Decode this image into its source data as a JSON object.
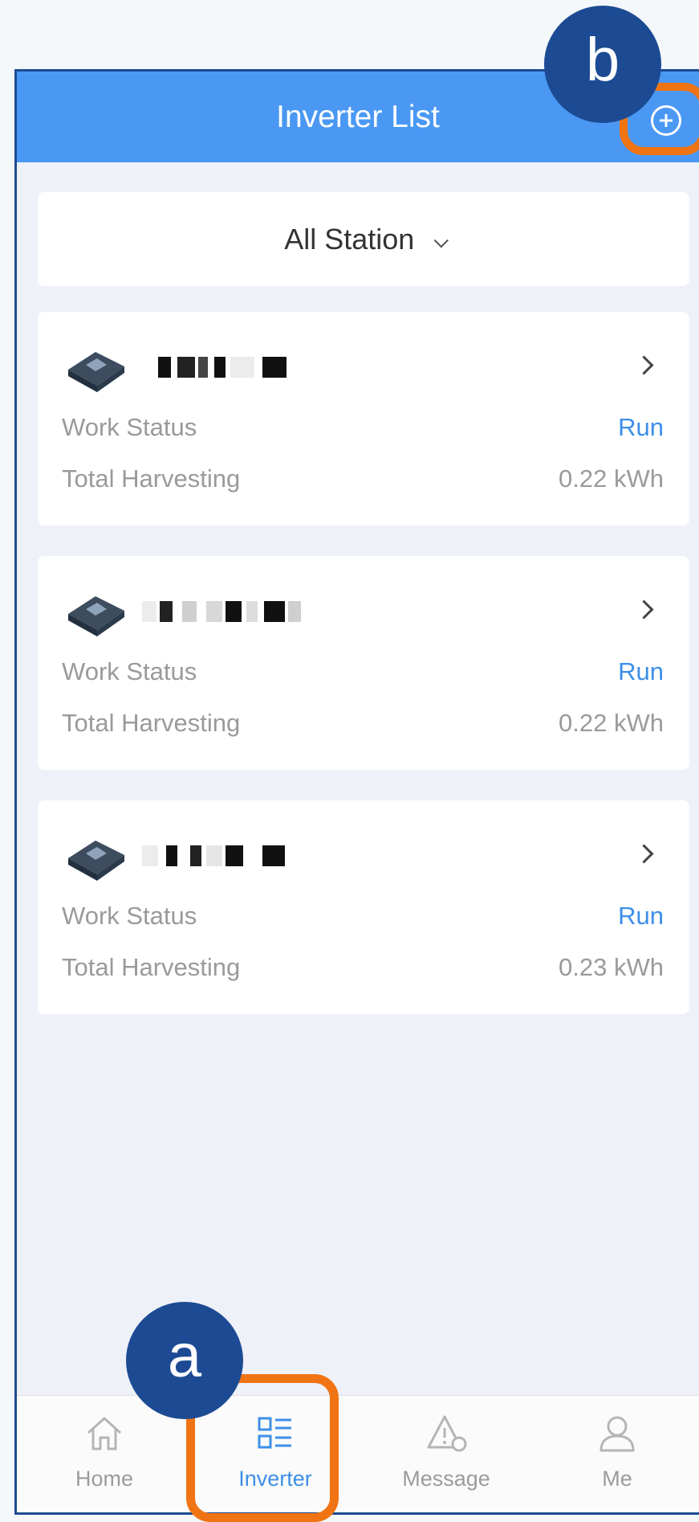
{
  "header": {
    "title": "Inverter List",
    "add_icon": "plus-circle-icon"
  },
  "station_filter": {
    "selected": "All Station"
  },
  "inverters": [
    {
      "status_label": "Work Status",
      "status_value": "Run",
      "harvest_label": "Total Harvesting",
      "harvest_value": "0.22 kWh"
    },
    {
      "status_label": "Work Status",
      "status_value": "Run",
      "harvest_label": "Total Harvesting",
      "harvest_value": "0.22 kWh"
    },
    {
      "status_label": "Work Status",
      "status_value": "Run",
      "harvest_label": "Total Harvesting",
      "harvest_value": "0.23 kWh"
    }
  ],
  "tabbar": {
    "items": [
      {
        "label": "Home",
        "icon": "home-icon"
      },
      {
        "label": "Inverter",
        "icon": "inverter-list-icon",
        "active": true
      },
      {
        "label": "Message",
        "icon": "alert-icon"
      },
      {
        "label": "Me",
        "icon": "user-icon"
      }
    ]
  },
  "annotations": {
    "a": "a",
    "b": "b"
  },
  "colors": {
    "header": "#4a98f3",
    "accent": "#3d8fe8",
    "highlight": "#f07414",
    "badge": "#1c4b94"
  }
}
